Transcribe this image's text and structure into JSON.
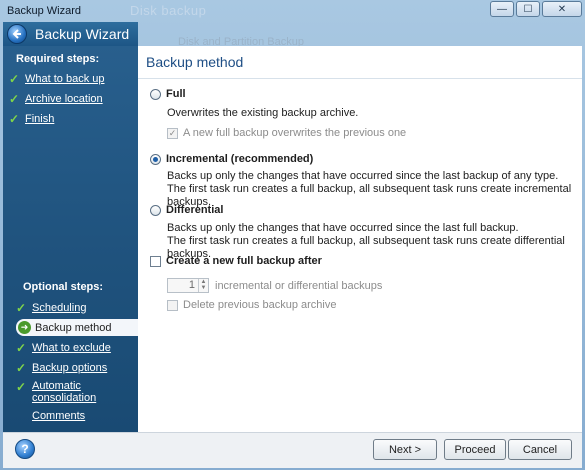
{
  "window": {
    "title": "Backup Wizard",
    "background_title": "Disk backup",
    "background_subtitle": "Disk and Partition Backup",
    "controls": {
      "minimize": "—",
      "maximize": "☐",
      "close": "✕"
    }
  },
  "header": {
    "title": "Backup Wizard",
    "back_icon": "back-arrow-icon"
  },
  "sidebar": {
    "required_heading": "Required steps:",
    "required_items": [
      {
        "label": "What to back up"
      },
      {
        "label": "Archive location"
      },
      {
        "label": "Finish"
      }
    ],
    "optional_heading": "Optional steps:",
    "optional_items": [
      {
        "label": "Scheduling",
        "state": "done"
      },
      {
        "label": "Backup method",
        "state": "active"
      },
      {
        "label": "What to exclude",
        "state": "done"
      },
      {
        "label": "Backup options",
        "state": "done"
      },
      {
        "label": "Automatic consolidation",
        "state": "done"
      },
      {
        "label": "Comments",
        "state": "none"
      }
    ]
  },
  "content": {
    "title": "Backup method",
    "full": {
      "label": "Full",
      "selected": false,
      "description": "Overwrites the existing backup archive.",
      "sub_checkbox": {
        "label": "A new full backup overwrites the previous one",
        "checked": true,
        "disabled": true
      }
    },
    "incremental": {
      "label": "Incremental (recommended)",
      "selected": true,
      "description_1": "Backs up only the changes that have occurred since the last backup of any type.",
      "description_2": "The first task run creates a full backup, all subsequent task runs create incremental backups."
    },
    "differential": {
      "label": "Differential",
      "selected": false,
      "description_1": "Backs up only the changes that have occurred since the last full backup.",
      "description_2": "The first task run creates a full backup, all subsequent task runs create differential backups."
    },
    "new_full": {
      "label": "Create a new full backup after",
      "checked": false,
      "spinner_value": "1",
      "spinner_suffix": "incremental or differential backups",
      "delete_label": "Delete previous backup archive",
      "delete_checked": false
    }
  },
  "footer": {
    "help_label": "?",
    "next_label": "Next >",
    "proceed_label": "Proceed",
    "cancel_label": "Cancel"
  },
  "colors": {
    "accent": "#1e4e85",
    "sidebar": "#1f527d",
    "check": "#7fd44a"
  }
}
